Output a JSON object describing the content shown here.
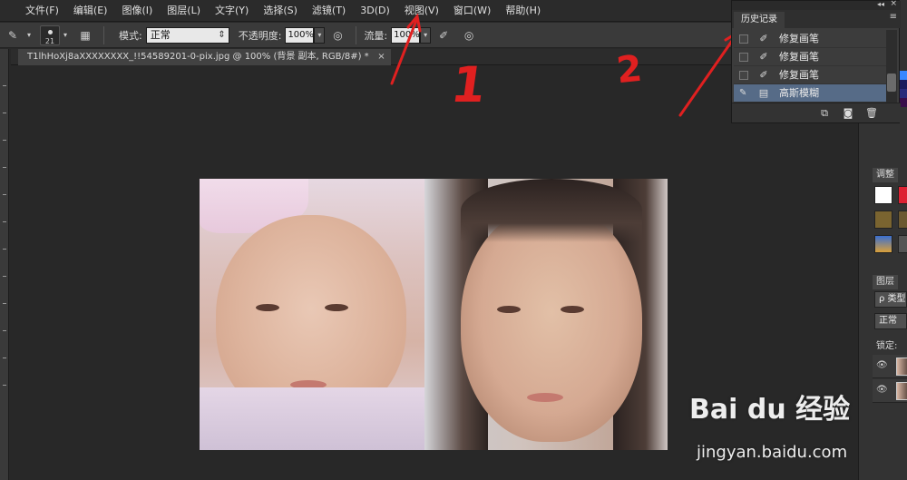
{
  "menubar": {
    "items": [
      "文件(F)",
      "编辑(E)",
      "图像(I)",
      "图层(L)",
      "文字(Y)",
      "选择(S)",
      "滤镜(T)",
      "3D(D)",
      "视图(V)",
      "窗口(W)",
      "帮助(H)"
    ]
  },
  "options": {
    "brush_size": "21",
    "mode_label": "模式:",
    "mode_value": "正常",
    "opacity_label": "不透明度:",
    "opacity_value": "100%",
    "flow_label": "流量:",
    "flow_value": "100%"
  },
  "document": {
    "tab_title": "T1lhHoXj8aXXXXXXXX_!!54589201-0-pix.jpg @ 100% (背景 副本, RGB/8#) *",
    "close_glyph": "×"
  },
  "history": {
    "tab_label": "历史记录",
    "collapse_glyph": "◂◂",
    "close_glyph": "×",
    "menu_glyph": "≡",
    "items": [
      {
        "label": "修复画笔",
        "icon": "bandage-icon",
        "active": false
      },
      {
        "label": "修复画笔",
        "icon": "bandage-icon",
        "active": false
      },
      {
        "label": "修复画笔",
        "icon": "bandage-icon",
        "active": false
      },
      {
        "label": "高斯模糊",
        "icon": "document-icon",
        "active": true
      }
    ]
  },
  "dock": {
    "adjust_tab": "调整",
    "layers_tab": "图层",
    "kind_filter": "ρ 类型",
    "blend_mode": "正常",
    "lock_label": "锁定:"
  },
  "annotations": {
    "one": "1",
    "two": "2"
  },
  "watermark": {
    "brand": "Bai du 经验",
    "url": "jingyan.baidu.com"
  },
  "colors": {
    "annotation": "#e02020",
    "history_active": "#566b87"
  }
}
